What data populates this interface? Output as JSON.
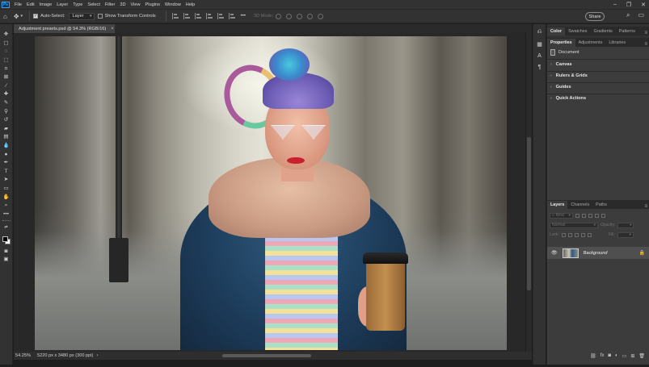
{
  "app": {
    "logo": "Ps",
    "menu": [
      "File",
      "Edit",
      "Image",
      "Layer",
      "Type",
      "Select",
      "Filter",
      "3D",
      "View",
      "Plugins",
      "Window",
      "Help"
    ]
  },
  "options_bar": {
    "auto_select_label": "Auto-Select:",
    "auto_select_checked": true,
    "layer_select_value": "Layer",
    "transform_controls_label": "Show Transform Controls",
    "transform_controls_checked": false,
    "mode_3d_label": "3D Mode:",
    "share_label": "Share"
  },
  "document": {
    "tab_title": "Adjustment presets.psd @ 54.3% (RGB/16)",
    "close_glyph": "×"
  },
  "status_bar": {
    "zoom": "54.25%",
    "doc_info": "5220 px x 3480 px (300 ppi)"
  },
  "panels": {
    "color_group_tabs": [
      "Color",
      "Swatches",
      "Gradients",
      "Patterns"
    ],
    "properties_group_tabs": [
      "Properties",
      "Adjustments",
      "Libraries"
    ],
    "properties": {
      "document_label": "Document",
      "sections": [
        "Canvas",
        "Rulers & Grids",
        "Guides",
        "Quick Actions"
      ]
    },
    "layers_group_tabs": [
      "Layers",
      "Channels",
      "Paths"
    ],
    "layers": {
      "filter_kind": "Kind",
      "blend_mode": "Normal",
      "opacity_label": "Opacity:",
      "lock_label": "Lock:",
      "fill_label": "Fill:",
      "items": [
        {
          "name": "Background",
          "visible": true,
          "locked": true
        }
      ]
    }
  },
  "colors": {
    "accent_blue": "#31a8ff",
    "panel_bg": "#323232",
    "canvas_bg": "#282828"
  }
}
